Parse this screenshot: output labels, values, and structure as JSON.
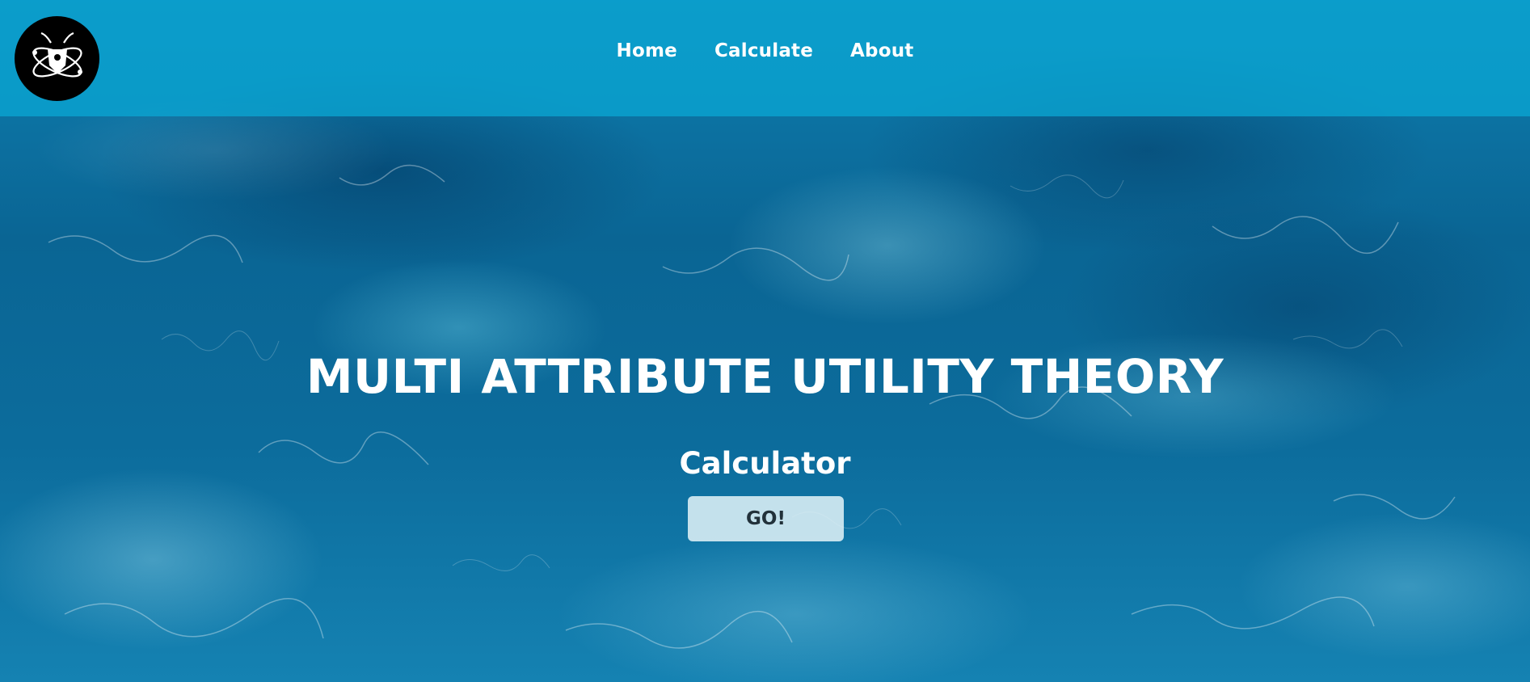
{
  "nav": {
    "logo_icon": "atom-bug-logo",
    "links": [
      {
        "label": "Home"
      },
      {
        "label": "Calculate"
      },
      {
        "label": "About"
      }
    ]
  },
  "hero": {
    "title": "MULTI ATTRIBUTE UTILITY THEORY",
    "subtitle": "Calculator",
    "button_label": "GO!"
  },
  "colors": {
    "navbar": "#0aa5d2",
    "background": "#0a6594",
    "logo_bg": "#000000",
    "text": "#ffffff",
    "button_bg": "#def0f6",
    "button_text": "#22313a"
  }
}
